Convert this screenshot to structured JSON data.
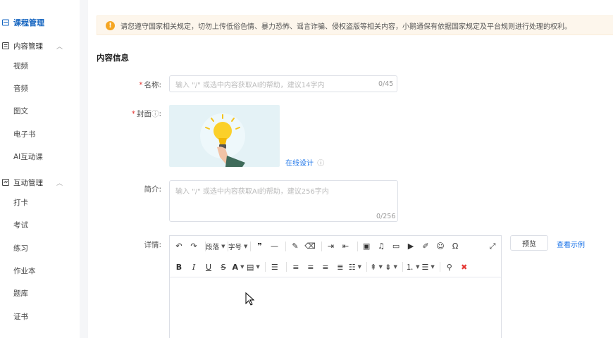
{
  "sidebar": {
    "top_item": "课程管理",
    "groups": [
      {
        "label": "内容管理",
        "items": [
          "视频",
          "音频",
          "图文",
          "电子书",
          "AI互动课"
        ]
      },
      {
        "label": "互动管理",
        "items": [
          "打卡",
          "考试",
          "练习",
          "作业本",
          "题库",
          "证书"
        ]
      }
    ]
  },
  "notice": {
    "icon": "warning-icon",
    "text": "请您遵守国家相关规定，切勿上传低俗色情、暴力恐怖、谣言诈骗、侵权盗版等相关内容，小鹅通保有依据国家规定及平台规则进行处理的权利。"
  },
  "form": {
    "section_title": "内容信息",
    "name": {
      "required_mark": "*",
      "label": "名称:",
      "placeholder": "输入 \"/\" 或选中内容获取AI的帮助，建议14字内",
      "counter": "0/45"
    },
    "cover": {
      "required_mark": "*",
      "label": "封面",
      "info_icon": "ⓘ",
      "colon": ":",
      "online_design": "在线设计",
      "online_design_info": "ⓘ"
    },
    "intro": {
      "label": "简介:",
      "placeholder": "输入 \"/\" 或选中内容获取AI的帮助，建议256字内",
      "counter": "0/256"
    },
    "detail": {
      "label": "详情:",
      "preview_button": "预览",
      "example_link": "查看示例",
      "toolbar_row1": {
        "paragraph": "段落",
        "font_size": "字号"
      },
      "toolbar_row2_bold": "B",
      "toolbar_row2_italic": "I",
      "toolbar_row2_underline": "U",
      "toolbar_row2_strike": "S",
      "toolbar_row2_fontcolor": "A",
      "toolbar_row1_omega": "Ω"
    }
  },
  "colors": {
    "accent": "#1a73e8",
    "sidebar_active": "#1565c0",
    "required": "#e53935",
    "warning": "#f5a623",
    "notice_bg": "#fdf6ec"
  }
}
